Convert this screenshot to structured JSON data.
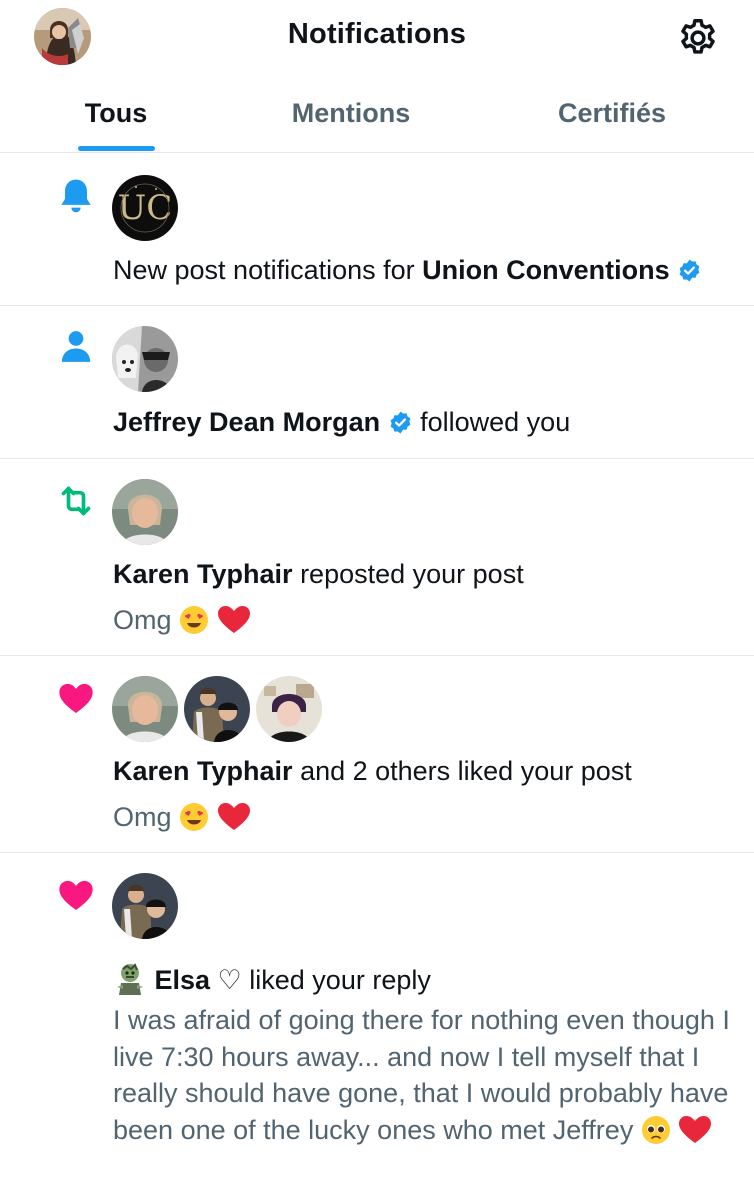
{
  "header": {
    "title": "Notifications",
    "avatar_icon": "user-avatar",
    "settings_icon": "gear-icon"
  },
  "tabs": [
    {
      "label": "Tous",
      "active": true
    },
    {
      "label": "Mentions",
      "active": false
    },
    {
      "label": "Certifiés",
      "active": false
    }
  ],
  "notifications": [
    {
      "type_icon": "bell-icon",
      "text_prefix": "New post notifications for ",
      "name": "Union Conventions",
      "verified": true
    },
    {
      "type_icon": "person-icon",
      "name": "Jeffrey Dean Morgan",
      "verified": true,
      "text_suffix": "followed you"
    },
    {
      "type_icon": "repost-icon",
      "name": "Karen Typhair",
      "text_suffix": " reposted your post",
      "snippet": "Omg"
    },
    {
      "type_icon": "heart-icon",
      "name": "Karen Typhair",
      "text_suffix": " and 2 others liked your post",
      "snippet": "Omg"
    },
    {
      "type_icon": "heart-icon",
      "name": "Elsa ♡",
      "text_suffix": " liked your reply",
      "snippet": "I was afraid of going there for nothing even though I live 7:30 hours away... and now I tell myself that I really should have gone, that I would probably have been one of the lucky ones who met Jeffrey"
    }
  ],
  "colors": {
    "accent": "#1d9bf0",
    "repost": "#00ba7c",
    "like": "#f91880",
    "secondary_text": "#536471"
  }
}
